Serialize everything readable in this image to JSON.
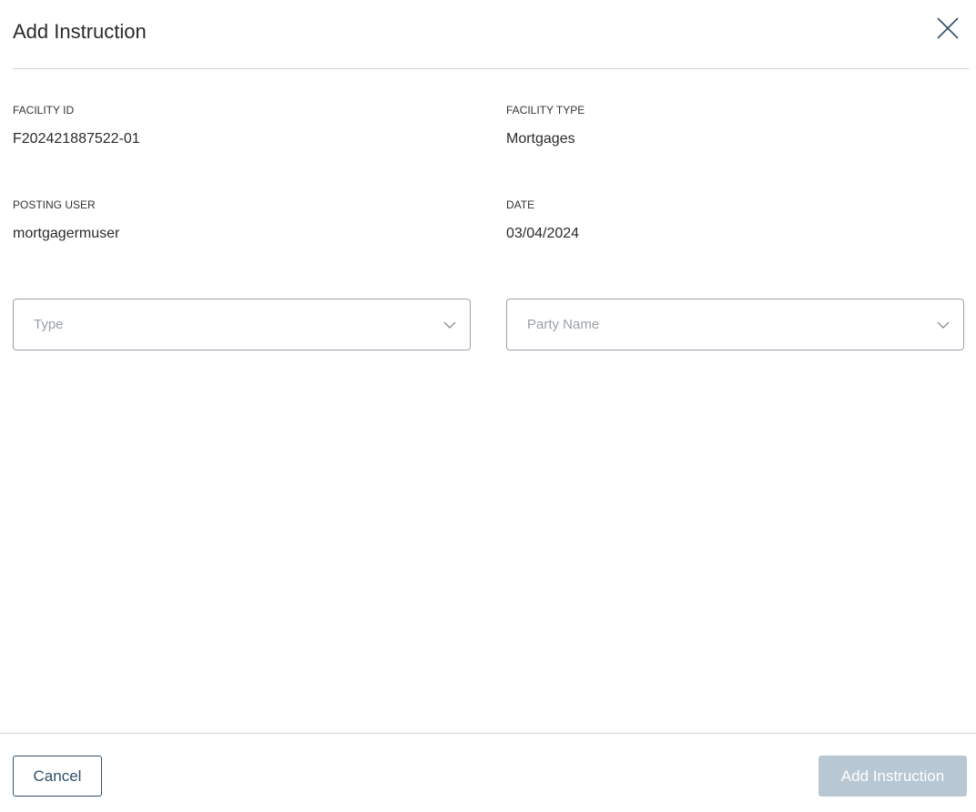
{
  "dialog": {
    "title": "Add Instruction",
    "close_icon": "close-icon"
  },
  "details": {
    "facility_id": {
      "label": "FACILITY ID",
      "value": "F202421887522-01"
    },
    "facility_type": {
      "label": "FACILITY TYPE",
      "value": "Mortgages"
    },
    "posting_user": {
      "label": "POSTING USER",
      "value": "mortgagermuser"
    },
    "date": {
      "label": "DATE",
      "value": "03/04/2024"
    }
  },
  "form": {
    "type": {
      "placeholder": "Type",
      "icon": "chevron-down-icon"
    },
    "party_name": {
      "placeholder": "Party Name",
      "icon": "chevron-down-icon"
    }
  },
  "footer": {
    "cancel_label": "Cancel",
    "add_label": "Add Instruction",
    "add_disabled": true
  },
  "colors": {
    "primary": "#2f4f6b",
    "disabled_button": "#b7c7d3",
    "border": "#9aa3ab",
    "divider": "#d6d6d6",
    "placeholder": "#9aa0a6"
  }
}
